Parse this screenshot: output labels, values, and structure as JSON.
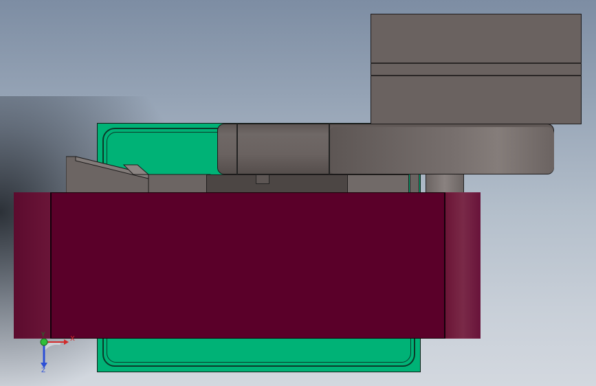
{
  "viewport": {
    "background_top": "#7d8da3",
    "background_bottom": "#d3d8df"
  },
  "model": {
    "base_plate_color": "#00b276",
    "conveyor_block_color": "#5a0029",
    "gripper_color": "#6a6260"
  },
  "triad": {
    "x_label": "X",
    "y_label": "Y",
    "z_label": "Z",
    "x_color": "#d22b2b",
    "y_color": "#2fbf3a",
    "z_color": "#2c4fd6"
  }
}
